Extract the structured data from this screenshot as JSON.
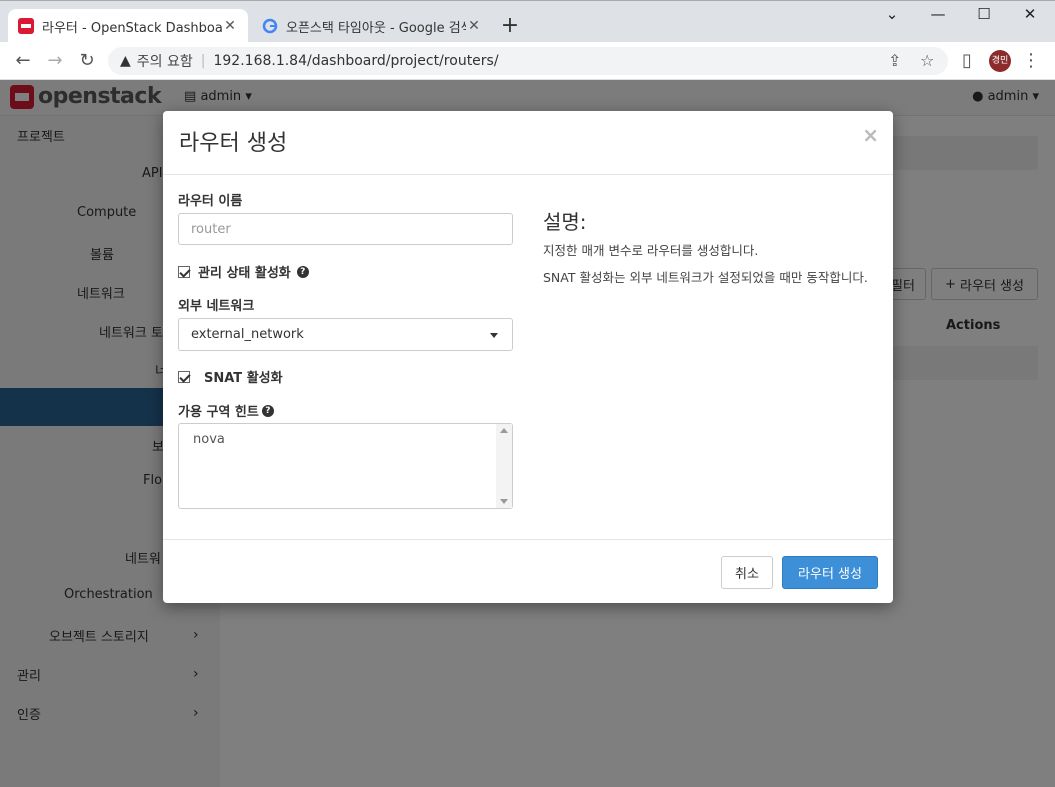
{
  "browser": {
    "tabs": [
      {
        "title": "라우터 - OpenStack Dashboard",
        "active": true
      },
      {
        "title": "오픈스택 타임아웃 - Google 검색",
        "active": false
      }
    ],
    "new_tab": "+",
    "security_label": "주의 요함",
    "url": "192.168.1.84/dashboard/project/routers/",
    "profile_initials": "경민"
  },
  "header": {
    "logo_text": "openstack",
    "project": "admin",
    "user": "admin"
  },
  "sidebar": {
    "items": [
      {
        "label": "프로젝트"
      },
      {
        "label": "API"
      },
      {
        "label": "Compute"
      },
      {
        "label": "볼륨"
      },
      {
        "label": "네트워크"
      },
      {
        "label": "네트워크 토"
      },
      {
        "label": "너"
      },
      {
        "label": "보"
      },
      {
        "label": "Flo"
      },
      {
        "label": "네트워"
      },
      {
        "label": "Orchestration"
      },
      {
        "label": "오브젝트 스토리지"
      },
      {
        "label": "관리"
      },
      {
        "label": "인증"
      }
    ]
  },
  "main": {
    "filter_button": "필터",
    "create_button": "라우터 생성",
    "actions_header": "Actions"
  },
  "modal": {
    "title": "라우터 생성",
    "close": "×",
    "router_name_label": "라우터 이름",
    "router_name_value": "router",
    "admin_state_label": "관리 상태 활성화",
    "external_network_label": "외부 네트워크",
    "external_network_value": "external_network",
    "snat_label": "SNAT 활성화",
    "az_hint_label": "가용 구역 힌트",
    "az_hint_value": "nova",
    "desc_title": "설명:",
    "desc_line1": "지정한 매개 변수로 라우터를 생성합니다.",
    "desc_line2": "SNAT 활성화는 외부 네트워크가 설정되었을 때만 동작합니다.",
    "cancel_button": "취소",
    "submit_button": "라우터 생성"
  },
  "colors": {
    "primary": "#3d8fd8",
    "sidebar_active": "#2a6496",
    "brand_red": "#da1a32"
  }
}
